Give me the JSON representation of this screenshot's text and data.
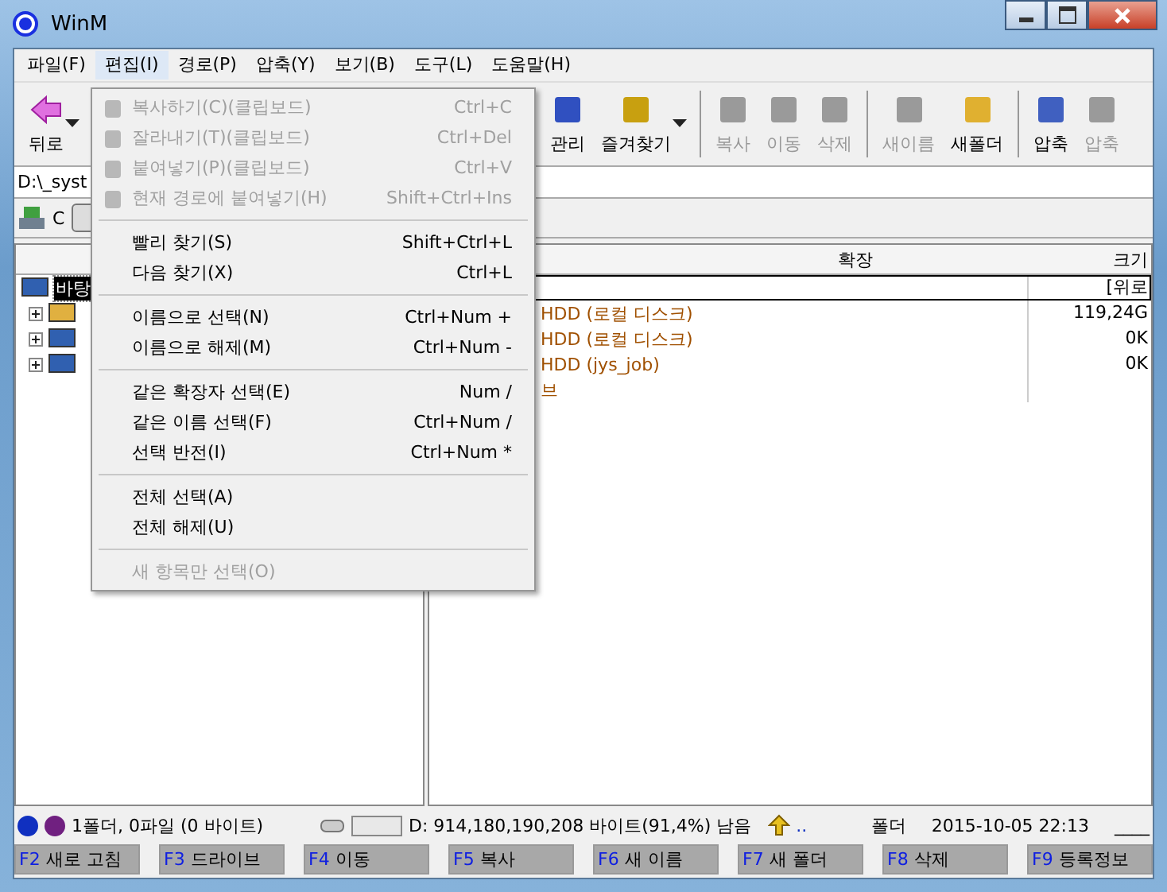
{
  "window": {
    "title": "WinM"
  },
  "menu_bar": [
    {
      "label": "파일(F)",
      "selected": false
    },
    {
      "label": "편집(I)",
      "selected": true
    },
    {
      "label": "경로(P)",
      "selected": false
    },
    {
      "label": "압축(Y)",
      "selected": false
    },
    {
      "label": "보기(B)",
      "selected": false
    },
    {
      "label": "도구(L)",
      "selected": false
    },
    {
      "label": "도움말(H)",
      "selected": false
    }
  ],
  "toolbar": [
    {
      "kind": "button",
      "label": "뒤로",
      "disabled": false,
      "dropdown": true
    },
    {
      "kind": "button",
      "label": "관리",
      "disabled": false
    },
    {
      "kind": "button",
      "label": "즐겨찾기",
      "disabled": false,
      "dropdown": true
    },
    {
      "kind": "separator"
    },
    {
      "kind": "button",
      "label": "복사",
      "disabled": true,
      "dropdown": false
    },
    {
      "kind": "button",
      "label": "이동",
      "disabled": true,
      "dropdown": false
    },
    {
      "kind": "button",
      "label": "삭제",
      "disabled": true,
      "dropdown": false
    },
    {
      "kind": "separator"
    },
    {
      "kind": "button",
      "label": "새이름",
      "disabled": true,
      "dropdown": false
    },
    {
      "kind": "button",
      "label": "새폴더",
      "disabled": false,
      "dropdown": false
    },
    {
      "kind": "separator"
    },
    {
      "kind": "button",
      "label": "압축",
      "disabled": false,
      "dropdown": false
    },
    {
      "kind": "button",
      "label": "압축",
      "disabled": true,
      "dropdown": false
    }
  ],
  "address": "D:\\_syst",
  "drive_bar": {
    "drive": "C"
  },
  "edit_menu": [
    {
      "kind": "item",
      "label": "복사하기(C)(클립보드)",
      "shortcut": "Ctrl+C",
      "disabled": true
    },
    {
      "kind": "item",
      "label": "잘라내기(T)(클립보드)",
      "shortcut": "Ctrl+Del",
      "disabled": true
    },
    {
      "kind": "item",
      "label": "붙여넣기(P)(클립보드)",
      "shortcut": "Ctrl+V",
      "disabled": true
    },
    {
      "kind": "item",
      "label": "현재 경로에 붙여넣기(H)",
      "shortcut": "Shift+Ctrl+Ins",
      "disabled": true
    },
    {
      "kind": "separator"
    },
    {
      "kind": "item",
      "label": "빨리 찾기(S)",
      "shortcut": "Shift+Ctrl+L",
      "disabled": false
    },
    {
      "kind": "item",
      "label": "다음 찾기(X)",
      "shortcut": "Ctrl+L",
      "disabled": false
    },
    {
      "kind": "separator"
    },
    {
      "kind": "item",
      "label": "이름으로 선택(N)",
      "shortcut": "Ctrl+Num +",
      "disabled": false
    },
    {
      "kind": "item",
      "label": "이름으로 해제(M)",
      "shortcut": "Ctrl+Num -",
      "disabled": false
    },
    {
      "kind": "separator"
    },
    {
      "kind": "item",
      "label": "같은 확장자 선택(E)",
      "shortcut": "Num /",
      "disabled": false
    },
    {
      "kind": "item",
      "label": "같은 이름 선택(F)",
      "shortcut": "Ctrl+Num /",
      "disabled": false
    },
    {
      "kind": "item",
      "label": "선택 반전(I)",
      "shortcut": "Ctrl+Num *",
      "disabled": false
    },
    {
      "kind": "separator"
    },
    {
      "kind": "item",
      "label": "전체 선택(A)",
      "disabled": false
    },
    {
      "kind": "item",
      "label": "전체 해제(U)",
      "disabled": false
    },
    {
      "kind": "separator"
    },
    {
      "kind": "item",
      "label": "새 항목만 선택(O)",
      "disabled": true
    }
  ],
  "tree": [
    {
      "label": "바탕",
      "selected": true
    },
    {
      "expandable": true
    },
    {
      "expandable": true
    },
    {
      "expandable": true
    }
  ],
  "file_list": {
    "columns": [
      "확장",
      "크기"
    ],
    "rows": [
      {
        "size": "[위로",
        "selected": true
      },
      {
        "name": "HDD (로컬 디스크)",
        "size": "119,24G",
        "selected": false
      },
      {
        "name": "HDD (로컬 디스크)",
        "size": "0K",
        "selected": false
      },
      {
        "name": "HDD (jys_job)",
        "size": "0K",
        "selected": false
      },
      {
        "name": "브",
        "selected": false
      }
    ]
  },
  "status_bar": {
    "counts": "1폴더, 0파일 (0 바이트)",
    "free_space": "D: 914,180,190,208 바이트(91,4%) 남음",
    "up": "..",
    "type": "폴더",
    "date": "2015-10-05 22:13",
    "attr": "____"
  },
  "function_keys": [
    {
      "key": "F2",
      "label": "새로 고침"
    },
    {
      "key": "F3",
      "label": "드라이브"
    },
    {
      "key": "F4",
      "label": "이동"
    },
    {
      "key": "F5",
      "label": "복사"
    },
    {
      "key": "F6",
      "label": "새 이름"
    },
    {
      "key": "F7",
      "label": "새 폴더"
    },
    {
      "key": "F8",
      "label": "삭제"
    },
    {
      "key": "F9",
      "label": "등록정보"
    }
  ]
}
